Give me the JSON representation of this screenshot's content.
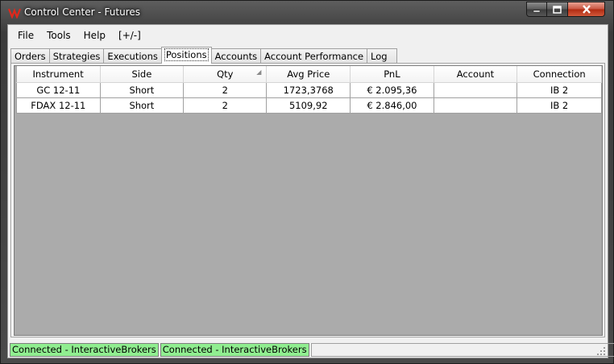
{
  "window": {
    "title": "Control Center - Futures"
  },
  "menu": {
    "items": [
      "File",
      "Tools",
      "Help",
      "[+/-]"
    ]
  },
  "tabs": [
    {
      "label": "Orders",
      "active": false
    },
    {
      "label": "Strategies",
      "active": false
    },
    {
      "label": "Executions",
      "active": false
    },
    {
      "label": "Positions",
      "active": true
    },
    {
      "label": "Accounts",
      "active": false
    },
    {
      "label": "Account Performance",
      "active": false
    },
    {
      "label": "Log",
      "active": false
    }
  ],
  "positions": {
    "columns": [
      "Instrument",
      "Side",
      "Qty",
      "Avg Price",
      "PnL",
      "Account",
      "Connection"
    ],
    "rows": [
      {
        "instrument": "GC 12-11",
        "side": "Short",
        "qty": "2",
        "avg_price": "1723,3768",
        "pnl": "€ 2.095,36",
        "account": "",
        "connection": "IB 2"
      },
      {
        "instrument": "FDAX 12-11",
        "side": "Short",
        "qty": "2",
        "avg_price": "5109,92",
        "pnl": "€ 2.846,00",
        "account": "",
        "connection": "IB 2"
      }
    ]
  },
  "status": {
    "panels": [
      "Connected - InteractiveBrokers",
      "Connected - InteractiveBrokers"
    ],
    "connected_color": "#90ee90"
  },
  "icons": {
    "app": "ninja-logo-icon",
    "minimize": "minimize-icon",
    "maximize": "maximize-icon",
    "close": "close-icon",
    "sort": "sort-icon",
    "grip": "resize-grip-icon"
  }
}
